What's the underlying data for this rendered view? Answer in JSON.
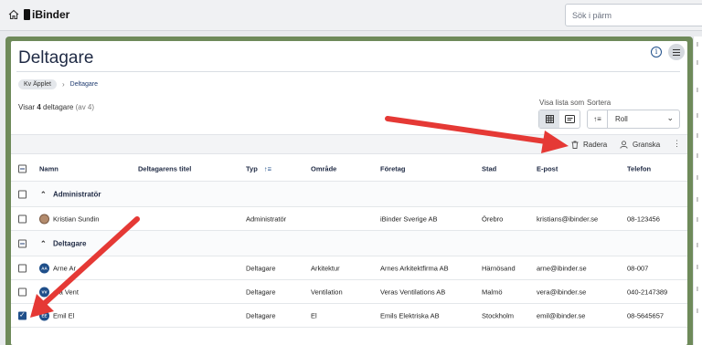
{
  "topbar": {
    "logo_text": "iBinder",
    "search_placeholder": "Sök i pärm"
  },
  "page": {
    "title": "Deltagare",
    "breadcrumb": [
      "Kv Äpplet",
      "Deltagare"
    ],
    "showing_prefix": "Visar ",
    "showing_count": "4",
    "showing_suffix": " deltagare",
    "showing_total": "(av 4)",
    "view_label": "Visa lista som",
    "sort_label": "Sortera",
    "sort_value": "Roll"
  },
  "toolbar": {
    "delete_label": "Radera",
    "review_label": "Granska"
  },
  "table": {
    "headers": [
      "Namn",
      "Deltagarens titel",
      "Typ",
      "Område",
      "Företag",
      "Stad",
      "E-post",
      "Telefon"
    ],
    "groups": [
      {
        "label": "Administratör",
        "rows": [
          {
            "initials": "",
            "name": "Kristian Sundin",
            "title": "",
            "type": "Administratör",
            "area": "",
            "company": "iBinder Sverige AB",
            "city": "Örebro",
            "email": "kristians@ibinder.se",
            "phone": "08-123456",
            "checked": false
          }
        ]
      },
      {
        "label": "Deltagare",
        "rows": [
          {
            "initials": "AA",
            "name": "Arne Ar",
            "title": "",
            "type": "Deltagare",
            "area": "Arkitektur",
            "company": "Arnes Arkitektfirma AB",
            "city": "Härnösand",
            "email": "arne@ibinder.se",
            "phone": "08-007",
            "checked": false
          },
          {
            "initials": "VV",
            "name": "era Vent",
            "title": "",
            "type": "Deltagare",
            "area": "Ventilation",
            "company": "Veras Ventilations AB",
            "city": "Malmö",
            "email": "vera@ibinder.se",
            "phone": "040-2147389",
            "checked": false
          },
          {
            "initials": "EE",
            "name": "Emil El",
            "title": "",
            "type": "Deltagare",
            "area": "El",
            "company": "Emils Elektriska AB",
            "city": "Stockholm",
            "email": "emil@ibinder.se",
            "phone": "08-5645657",
            "checked": true
          }
        ]
      }
    ]
  },
  "colors": {
    "frame": "#6e8a5a",
    "accent": "#1f4f8a",
    "arrow": "#e53935"
  }
}
